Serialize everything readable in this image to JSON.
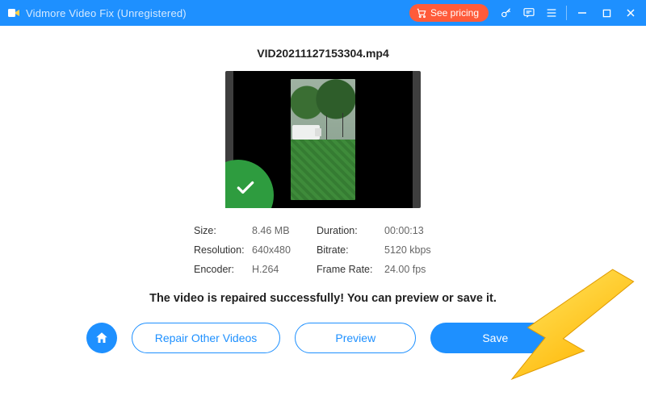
{
  "titlebar": {
    "app_name": "Vidmore Video Fix (Unregistered)",
    "pricing_label": "See pricing"
  },
  "main": {
    "filename": "VID20211127153304.mp4",
    "meta": {
      "size_label": "Size:",
      "size_value": "8.46 MB",
      "duration_label": "Duration:",
      "duration_value": "00:00:13",
      "resolution_label": "Resolution:",
      "resolution_value": "640x480",
      "bitrate_label": "Bitrate:",
      "bitrate_value": "5120 kbps",
      "encoder_label": "Encoder:",
      "encoder_value": "H.264",
      "framerate_label": "Frame Rate:",
      "framerate_value": "24.00 fps"
    },
    "success_message": "The video is repaired successfully! You can preview or save it."
  },
  "actions": {
    "repair_other": "Repair Other Videos",
    "preview": "Preview",
    "save": "Save"
  }
}
